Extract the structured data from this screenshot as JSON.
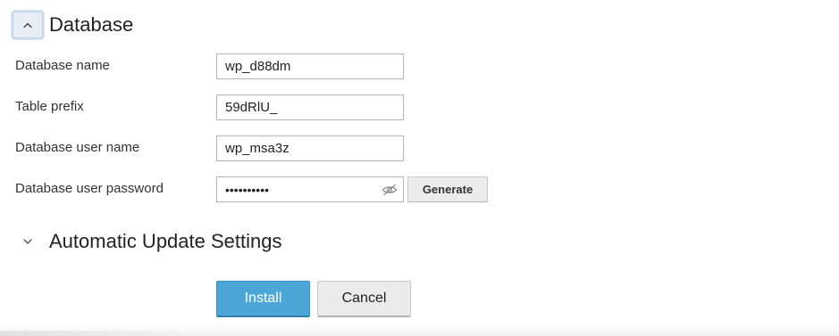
{
  "database_section": {
    "title": "Database",
    "toggle_icon": "chevron-up-icon",
    "fields": {
      "db_name": {
        "label": "Database name",
        "value": "wp_d88dm"
      },
      "table_prefix": {
        "label": "Table prefix",
        "value": "59dRlU_"
      },
      "db_user": {
        "label": "Database user name",
        "value": "wp_msa3z"
      },
      "db_password": {
        "label": "Database user password",
        "value": "••••••••••",
        "toggle_icon": "eye-slash-icon",
        "generate_label": "Generate"
      }
    }
  },
  "auto_update_section": {
    "title": "Automatic Update Settings",
    "toggle_icon": "chevron-down-icon"
  },
  "actions": {
    "install_label": "Install",
    "cancel_label": "Cancel"
  },
  "colors": {
    "primary_button": "#4da6d8",
    "secondary_button": "#ebebeb",
    "focus_highlight": "#e8eef6"
  }
}
